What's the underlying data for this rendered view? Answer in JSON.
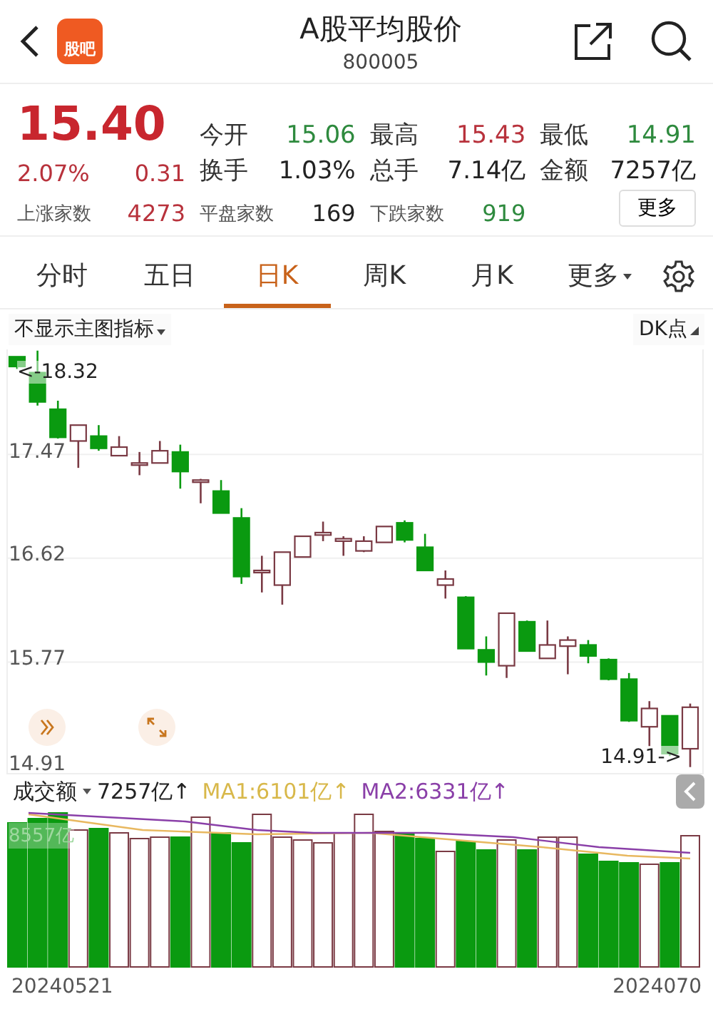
{
  "header": {
    "logo_text": "股吧",
    "title": "A股平均股价",
    "code": "800005"
  },
  "quote": {
    "price": "15.40",
    "change_pct": "2.07%",
    "change": "0.31",
    "stats": [
      {
        "label": "今开",
        "value": "15.06",
        "color": "#2e8a3e"
      },
      {
        "label": "最高",
        "value": "15.43",
        "color": "#b8323c"
      },
      {
        "label": "最低",
        "value": "14.91",
        "color": "#2e8a3e"
      },
      {
        "label": "换手",
        "value": "1.03%",
        "color": "#222222"
      },
      {
        "label": "总手",
        "value": "7.14亿",
        "color": "#222222"
      },
      {
        "label": "金额",
        "value": "7257亿",
        "color": "#222222"
      }
    ],
    "breadth": [
      {
        "label": "上涨家数",
        "value": "4273",
        "color": "#b8323c"
      },
      {
        "label": "平盘家数",
        "value": "169",
        "color": "#222222"
      },
      {
        "label": "下跌家数",
        "value": "919",
        "color": "#2e8a3e"
      }
    ],
    "more_button": "更多"
  },
  "tabs": [
    {
      "label": "分时",
      "selected": false,
      "has_menu": false
    },
    {
      "label": "五日",
      "selected": false,
      "has_menu": false
    },
    {
      "label": "日K",
      "selected": true,
      "has_menu": false
    },
    {
      "label": "周K",
      "selected": false,
      "has_menu": false
    },
    {
      "label": "月K",
      "selected": false,
      "has_menu": false
    },
    {
      "label": "更多",
      "selected": false,
      "has_menu": true
    }
  ],
  "chart": {
    "indicator_menu": "不显示主图指标",
    "dk_button": "DK点",
    "high_label": "<-18.32",
    "low_label": "14.91->",
    "chart_data": {
      "type": "candlestick",
      "grid": true,
      "ylim": [
        14.85,
        18.33
      ],
      "yticks": [
        17.47,
        16.62,
        15.77,
        14.91
      ],
      "ohlc": [
        [
          18.27,
          18.27,
          18.17,
          18.19
        ],
        [
          18.14,
          18.32,
          17.87,
          17.9
        ],
        [
          17.84,
          17.91,
          17.6,
          17.61
        ],
        [
          17.58,
          17.71,
          17.36,
          17.71
        ],
        [
          17.62,
          17.71,
          17.5,
          17.52
        ],
        [
          17.46,
          17.62,
          17.46,
          17.53
        ],
        [
          17.39,
          17.49,
          17.3,
          17.4
        ],
        [
          17.4,
          17.58,
          17.4,
          17.5
        ],
        [
          17.49,
          17.55,
          17.19,
          17.33
        ],
        [
          17.25,
          17.27,
          17.07,
          17.26
        ],
        [
          17.17,
          17.26,
          16.99,
          16.99
        ],
        [
          16.95,
          17.03,
          16.41,
          16.47
        ],
        [
          16.51,
          16.64,
          16.34,
          16.52
        ],
        [
          16.4,
          16.67,
          16.24,
          16.67
        ],
        [
          16.63,
          16.8,
          16.63,
          16.8
        ],
        [
          16.81,
          16.92,
          16.76,
          16.83
        ],
        [
          16.76,
          16.8,
          16.64,
          16.78
        ],
        [
          16.68,
          16.8,
          16.67,
          16.76
        ],
        [
          16.75,
          16.88,
          16.75,
          16.88
        ],
        [
          16.91,
          16.93,
          16.75,
          16.77
        ],
        [
          16.71,
          16.82,
          16.52,
          16.52
        ],
        [
          16.4,
          16.52,
          16.29,
          16.45
        ],
        [
          16.3,
          16.31,
          15.88,
          15.88
        ],
        [
          15.87,
          15.98,
          15.66,
          15.77
        ],
        [
          15.74,
          16.17,
          15.64,
          16.17
        ],
        [
          16.1,
          16.11,
          15.86,
          15.86
        ],
        [
          15.8,
          16.11,
          15.8,
          15.91
        ],
        [
          15.9,
          15.98,
          15.67,
          15.95
        ],
        [
          15.91,
          15.95,
          15.76,
          15.82
        ],
        [
          15.79,
          15.8,
          15.62,
          15.63
        ],
        [
          15.63,
          15.68,
          15.28,
          15.29
        ],
        [
          15.24,
          15.45,
          15.08,
          15.39
        ],
        [
          15.33,
          15.33,
          15.0,
          15.02
        ],
        [
          15.06,
          15.43,
          14.91,
          15.4
        ]
      ]
    }
  },
  "volume": {
    "label": "成交额",
    "value": "7257亿↑",
    "ma1": "MA1:6101亿↑",
    "ma2": "MA2:6331亿↑",
    "axis_top": "8557亿"
  },
  "dates": [
    "20240521",
    "2024070"
  ]
}
